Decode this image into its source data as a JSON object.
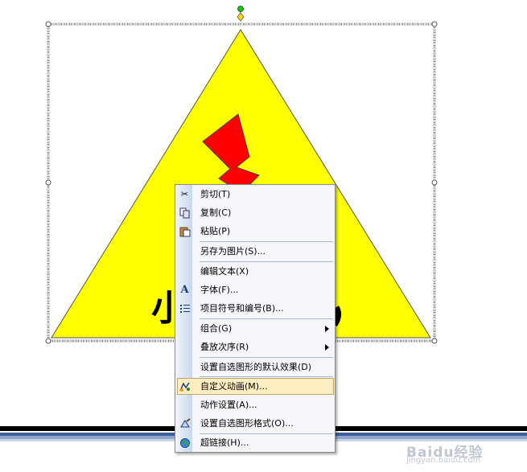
{
  "slide": {
    "shape_text_visible": "小",
    "colors": {
      "triangle_fill": "#ffff00",
      "lightning_fill": "#ff0000",
      "handle_green": "#00cc00",
      "handle_yellow": "#ffdd00"
    }
  },
  "context_menu": {
    "items": [
      {
        "label": "剪切(T)",
        "icon": "scissors-icon",
        "submenu": false
      },
      {
        "label": "复制(C)",
        "icon": "copy-icon",
        "submenu": false
      },
      {
        "label": "粘贴(P)",
        "icon": "paste-icon",
        "submenu": false
      },
      {
        "label": "另存为图片(S)...",
        "icon": "",
        "submenu": false
      },
      {
        "label": "编辑文本(X)",
        "icon": "",
        "submenu": false
      },
      {
        "label": "字体(F)...",
        "icon": "font-icon",
        "submenu": false
      },
      {
        "label": "项目符号和编号(B)...",
        "icon": "bullets-icon",
        "submenu": false
      },
      {
        "label": "组合(G)",
        "icon": "",
        "submenu": true
      },
      {
        "label": "叠放次序(R)",
        "icon": "",
        "submenu": true
      },
      {
        "label": "设置自选图形的默认效果(D)",
        "icon": "",
        "submenu": false
      },
      {
        "label": "自定义动画(M)...",
        "icon": "custom-animation-icon",
        "submenu": false,
        "highlighted": true
      },
      {
        "label": "动作设置(A)...",
        "icon": "",
        "submenu": false
      },
      {
        "label": "设置自选图形格式(O)...",
        "icon": "format-shape-icon",
        "submenu": false
      },
      {
        "label": "超链接(H)...",
        "icon": "hyperlink-globe-icon",
        "submenu": false
      }
    ],
    "highlight_color": "#ffeec2"
  },
  "watermark": {
    "brand": "Baidu经验",
    "url": "jingyan.baidu.com"
  }
}
